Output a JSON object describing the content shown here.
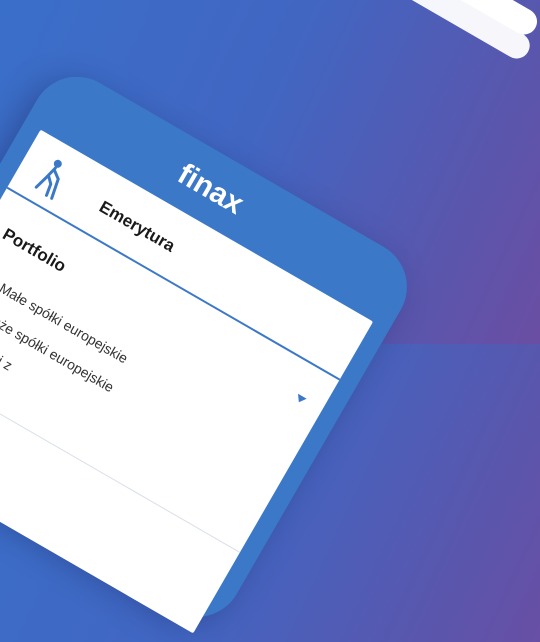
{
  "app": {
    "logo_text": "finax"
  },
  "goal": {
    "title": "Emerytura",
    "icon": "walking-person-with-cane-icon"
  },
  "portfolio": {
    "title": "Portfolio",
    "items": [
      {
        "label": "Małe spółki europejskie"
      },
      {
        "label": "Duże spółki europejskie"
      },
      {
        "label": "Spółki z"
      }
    ]
  },
  "colors": {
    "accent": "#3b79c8",
    "background_start": "#3a6fc9",
    "background_end": "#6a4ea3"
  }
}
